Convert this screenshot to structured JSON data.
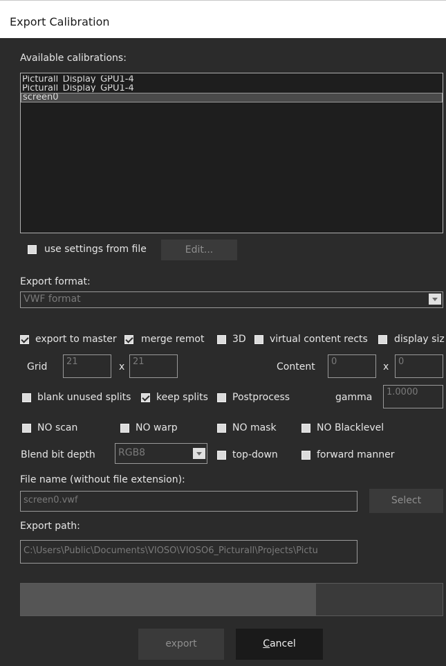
{
  "window": {
    "title": "Export Calibration"
  },
  "calibrations": {
    "label": "Available calibrations:",
    "items": [
      {
        "label": "Picturall_Display_GPU1-4",
        "selected": false
      },
      {
        "label": "Picturall_Display_GPU1-4",
        "selected": false
      },
      {
        "label": "screen0",
        "selected": true
      }
    ]
  },
  "use_settings": {
    "label": "use settings from file",
    "checked": false,
    "edit_label": "Edit..."
  },
  "export_format": {
    "label": "Export format:",
    "value": "VWF format"
  },
  "options_row1": [
    {
      "label": "export to master",
      "checked": true
    },
    {
      "label": "merge remot",
      "checked": true
    },
    {
      "label": "3D",
      "checked": false
    },
    {
      "label": "virtual content rects",
      "checked": false
    },
    {
      "label": "display siz",
      "checked": false
    }
  ],
  "grid": {
    "label": "Grid",
    "x": "21",
    "sep": "x",
    "y": "21"
  },
  "content": {
    "label": "Content",
    "x": "0",
    "sep": "x",
    "y": "0"
  },
  "options_row2": [
    {
      "label": "blank unused splits",
      "checked": false
    },
    {
      "label": "keep splits",
      "checked": true
    },
    {
      "label": "Postprocess",
      "checked": false
    }
  ],
  "gamma": {
    "label": "gamma",
    "value": "1.0000"
  },
  "options_row3": [
    {
      "label": "NO scan",
      "checked": false
    },
    {
      "label": "NO warp",
      "checked": false
    },
    {
      "label": "NO mask",
      "checked": false
    },
    {
      "label": "NO Blacklevel",
      "checked": false
    }
  ],
  "blend": {
    "label": "Blend bit depth",
    "value": "RGB8"
  },
  "options_row4": [
    {
      "label": "top-down",
      "checked": false
    },
    {
      "label": "forward manner",
      "checked": false
    }
  ],
  "file_name": {
    "label": "File name (without file extension):",
    "value": "screen0.vwf",
    "select_label": "Select"
  },
  "export_path": {
    "label": "Export path:",
    "value": "C:\\Users\\Public\\Documents\\VIOSO\\VIOSO6_Picturall\\Projects\\Pictu"
  },
  "progress": {
    "fraction": 0.7
  },
  "buttons": {
    "export": "export",
    "cancel_prefix": "C",
    "cancel_rest": "ancel"
  }
}
